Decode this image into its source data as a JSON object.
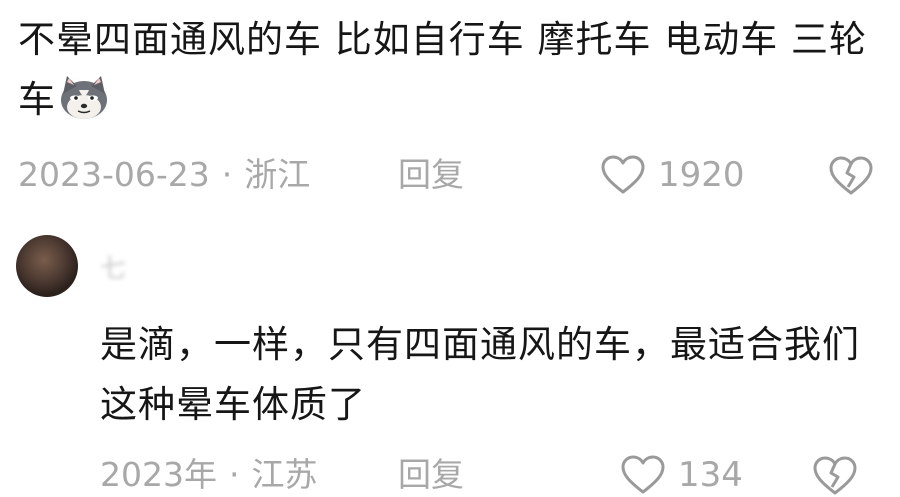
{
  "comment1": {
    "text": "不晕四面通风的车 比如自行车 摩托车 电动车 三轮车",
    "emoji": "husky-dog-emoji",
    "date": "2023-06-23",
    "separator": "·",
    "location": "浙江",
    "reply_label": "回复",
    "like_count": "1920"
  },
  "comment2": {
    "username": "七",
    "text": "是滴，一样，只有四面通风的车，最适合我们这种晕车体质了",
    "date": "2023年",
    "separator": "·",
    "location": "江苏",
    "reply_label": "回复",
    "like_count": "134"
  },
  "colors": {
    "text": "#161616",
    "meta": "#a8a8a8",
    "background": "#ffffff"
  }
}
